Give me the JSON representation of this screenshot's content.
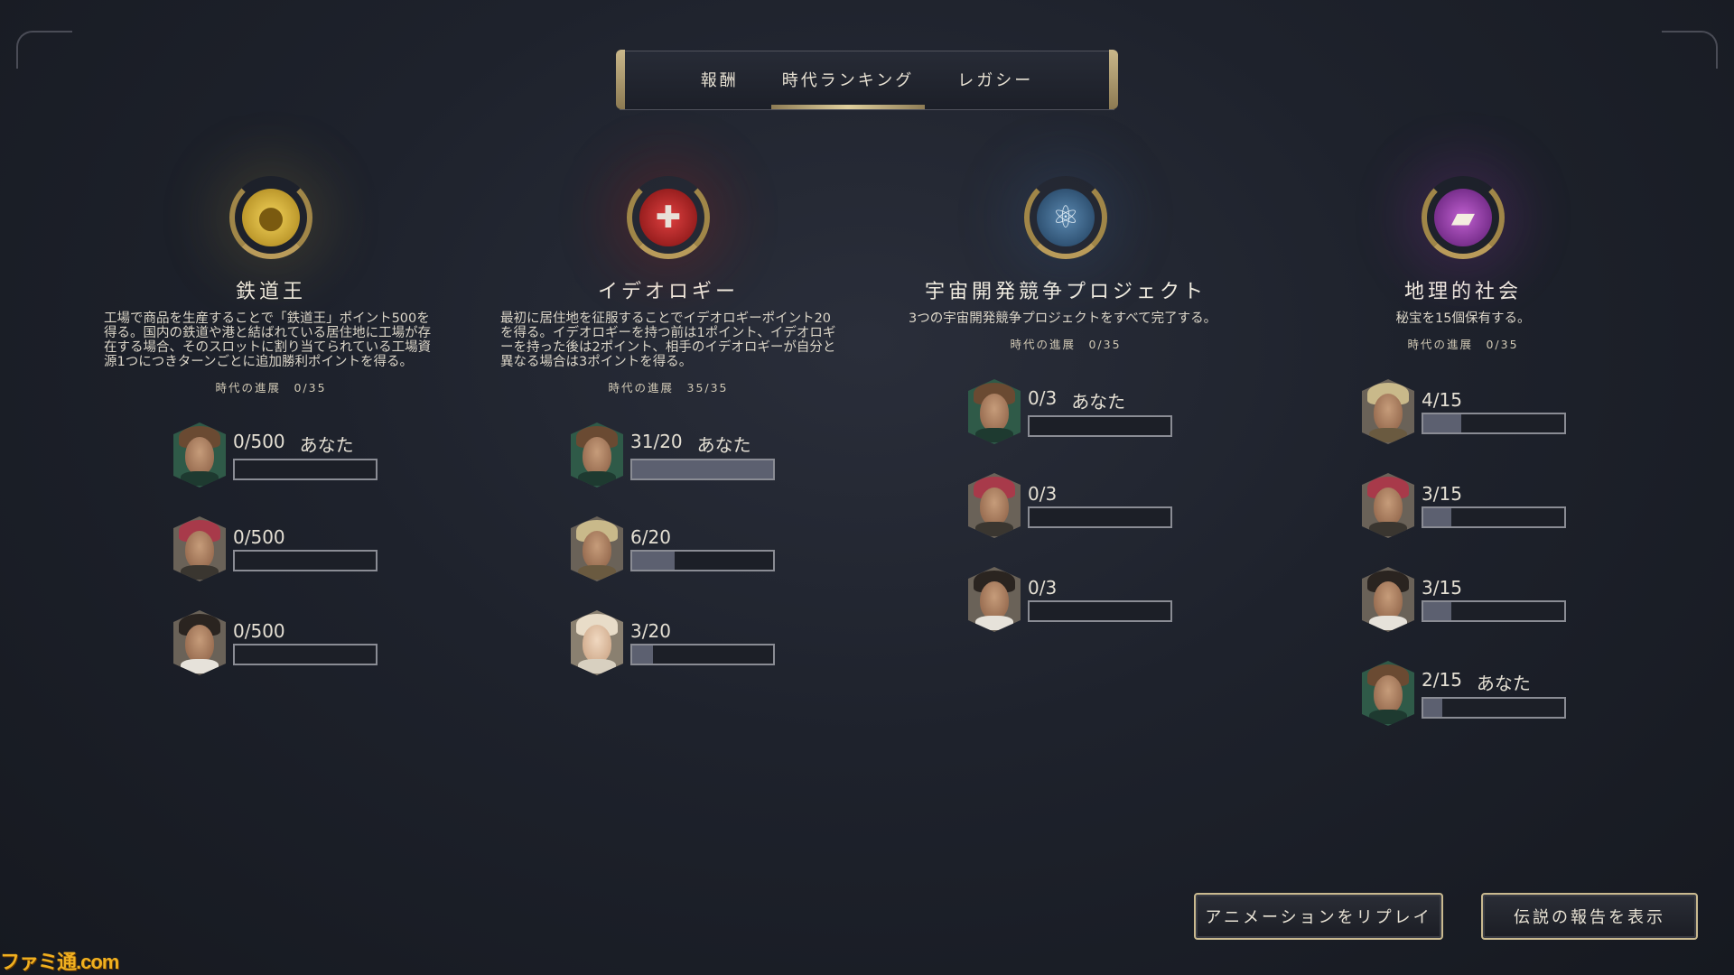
{
  "tabs": [
    {
      "label": "報酬"
    },
    {
      "label": "時代ランキング"
    },
    {
      "label": "レガシー"
    }
  ],
  "columns": [
    {
      "title": "鉄道王",
      "icon": "coins-icon",
      "description": "工場で商品を生産することで「鉄道王」ポイント500を得る。国内の鉄道や港と結ばれている居住地に工場が存在する場合、そのスロットに割り当てられている工場資源1つにつきターンごとに追加勝利ポイントを得る。",
      "progress": "時代の進展　0/35",
      "entries": [
        {
          "score": "0/500",
          "you": "あなた",
          "fill": 0
        },
        {
          "score": "0/500",
          "you": "",
          "fill": 0
        },
        {
          "score": "0/500",
          "you": "",
          "fill": 0
        }
      ]
    },
    {
      "title": "イデオロギー",
      "icon": "shield-sword-icon",
      "description": "最初に居住地を征服することでイデオロギーポイント20を得る。イデオロギーを持つ前は1ポイント、イデオロギーを持った後は2ポイント、相手のイデオロギーが自分と異なる場合は3ポイントを得る。",
      "progress": "時代の進展　35/35",
      "entries": [
        {
          "score": "31/20",
          "you": "あなた",
          "fill": 1.0
        },
        {
          "score": "6/20",
          "you": "",
          "fill": 0.3
        },
        {
          "score": "3/20",
          "you": "",
          "fill": 0.15
        }
      ]
    },
    {
      "title": "宇宙開発競争プロジェクト",
      "icon": "atom-icon",
      "description": "3つの宇宙開発競争プロジェクトをすべて完了する。",
      "progress": "時代の進展　0/35",
      "entries": [
        {
          "score": "0/3",
          "you": "あなた",
          "fill": 0
        },
        {
          "score": "0/3",
          "you": "",
          "fill": 0
        },
        {
          "score": "0/3",
          "you": "",
          "fill": 0
        }
      ]
    },
    {
      "title": "地理的社会",
      "icon": "book-icon",
      "description": "秘宝を15個保有する。",
      "progress": "時代の進展　0/35",
      "entries": [
        {
          "score": "4/15",
          "you": "",
          "fill": 0.267
        },
        {
          "score": "3/15",
          "you": "",
          "fill": 0.2
        },
        {
          "score": "3/15",
          "you": "",
          "fill": 0.2
        },
        {
          "score": "2/15",
          "you": "あなた",
          "fill": 0.133
        }
      ]
    }
  ],
  "buttons": {
    "replay": "アニメーションをリプレイ",
    "legend": "伝説の報告を表示"
  },
  "watermark": "ファミ通.com"
}
